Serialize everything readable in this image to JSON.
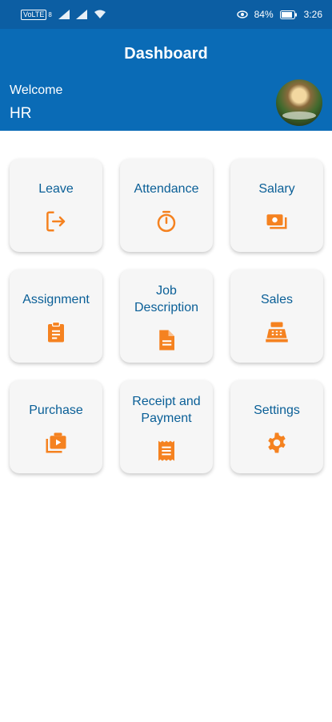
{
  "status_bar": {
    "network_chip": "VoLTE",
    "network_sub": "8",
    "battery": "84%",
    "time": "3:26"
  },
  "header": {
    "title": "Dashboard",
    "welcome_label": "Welcome",
    "user_name": "HR"
  },
  "tiles": [
    {
      "label": "Leave",
      "icon": "logout-icon"
    },
    {
      "label": "Attendance",
      "icon": "stopwatch-icon"
    },
    {
      "label": "Salary",
      "icon": "money-icon"
    },
    {
      "label": "Assignment",
      "icon": "clipboard-icon"
    },
    {
      "label": "Job\nDescription",
      "icon": "document-icon"
    },
    {
      "label": "Sales",
      "icon": "cash-register-icon"
    },
    {
      "label": "Purchase",
      "icon": "video-library-icon"
    },
    {
      "label": "Receipt and\nPayment",
      "icon": "receipt-icon"
    },
    {
      "label": "Settings",
      "icon": "gear-icon"
    }
  ],
  "colors": {
    "primary": "#0a6bb6",
    "status_bar": "#0c5ea3",
    "tile_text": "#0a5f97",
    "icon": "#f58220"
  }
}
